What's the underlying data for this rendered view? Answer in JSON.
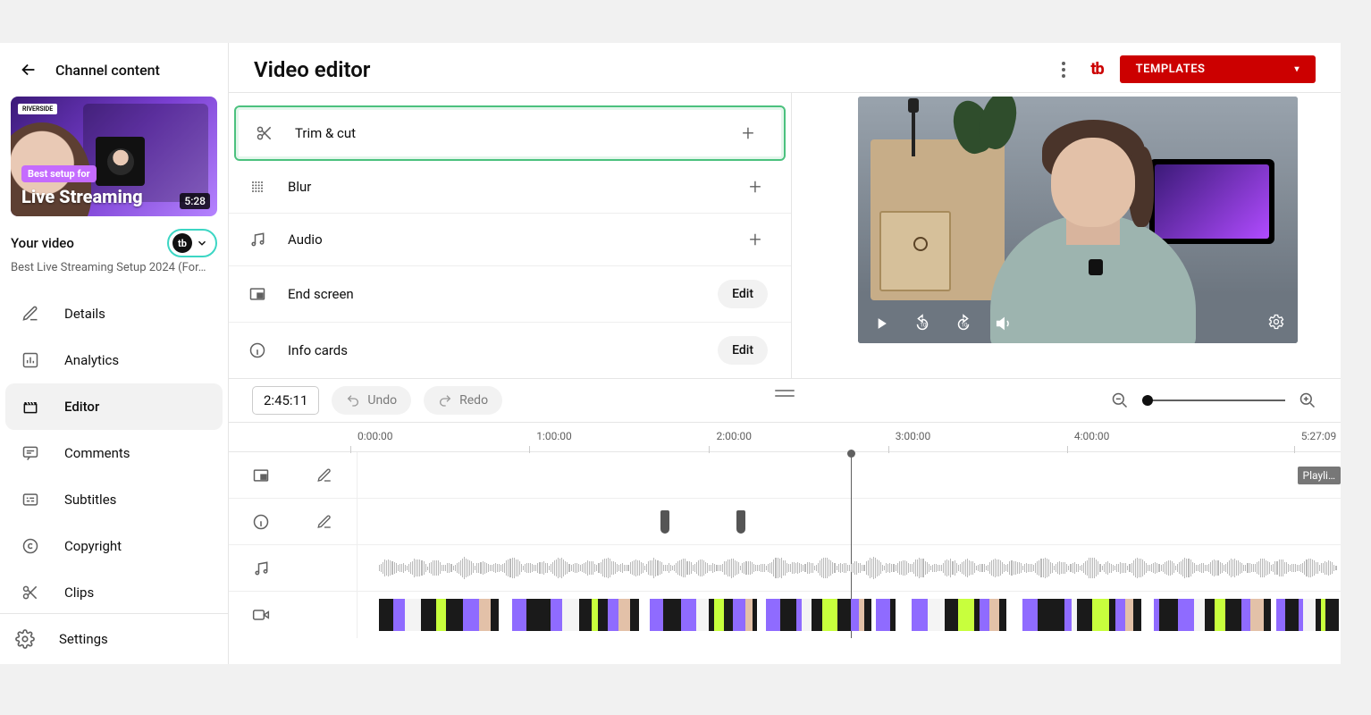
{
  "header": {
    "back_label": "Channel content",
    "page_title": "Video editor",
    "templates_btn": "TEMPLATES",
    "tb_logo": "tb"
  },
  "video": {
    "section_label": "Your video",
    "title": "Best Live Streaming Setup 2024 (For…",
    "thumb_badge_top": "RIVERSIDE",
    "thumb_badge_mid": "Best setup for",
    "thumb_title": "Live Streaming",
    "duration": "5:28"
  },
  "sidebar_items": [
    {
      "icon": "pencil",
      "label": "Details"
    },
    {
      "icon": "bar-chart",
      "label": "Analytics"
    },
    {
      "icon": "clapper",
      "label": "Editor",
      "active": true
    },
    {
      "icon": "comment",
      "label": "Comments"
    },
    {
      "icon": "subtitles",
      "label": "Subtitles"
    },
    {
      "icon": "copyright",
      "label": "Copyright"
    },
    {
      "icon": "scissors",
      "label": "Clips"
    }
  ],
  "sidebar_footer": {
    "icon": "gear",
    "label": "Settings"
  },
  "tools": [
    {
      "icon": "scissors",
      "label": "Trim & cut",
      "action": "plus",
      "highlight": true
    },
    {
      "icon": "blur",
      "label": "Blur",
      "action": "plus"
    },
    {
      "icon": "audio",
      "label": "Audio",
      "action": "plus"
    },
    {
      "icon": "endscreen",
      "label": "End screen",
      "action": "edit",
      "edit_label": "Edit"
    },
    {
      "icon": "info",
      "label": "Info cards",
      "action": "edit",
      "edit_label": "Edit"
    }
  ],
  "timeline": {
    "timecode": "2:45:11",
    "undo_label": "Undo",
    "redo_label": "Redo",
    "ticks": [
      "0:00:00",
      "1:00:00",
      "2:00:00",
      "3:00:00",
      "4:00:00",
      "5:27:09"
    ],
    "total_duration": "5:27:09",
    "playhead_pct": 50.5,
    "end_pill": "Playli…",
    "info_markers_pct": [
      31.0,
      38.8
    ],
    "zoom_level_pct": 0,
    "row_icons": [
      {
        "left": "endscreen",
        "right": "pencil"
      },
      {
        "left": "info",
        "right": "pencil"
      },
      {
        "left": "audio"
      },
      {
        "left": "video"
      }
    ]
  },
  "preview": {
    "controls": [
      "play",
      "rewind-10",
      "forward-10",
      "volume"
    ],
    "settings_icon": "gear"
  }
}
